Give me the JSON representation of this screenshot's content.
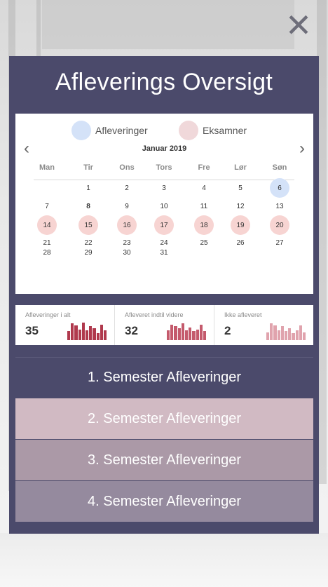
{
  "close_icon": "close-icon",
  "title": "Afleverings Oversigt",
  "legend": [
    {
      "label": "Afleveringer",
      "color": "#d4e2f8"
    },
    {
      "label": "Eksamner",
      "color": "#f0d8da"
    }
  ],
  "calendar": {
    "month": "Januar 2019",
    "prev_icon": "chevron-left-icon",
    "next_icon": "chevron-right-icon",
    "weekdays": [
      "Man",
      "Tir",
      "Ons",
      "Tors",
      "Fre",
      "Lør",
      "Søn"
    ],
    "weeks": [
      [
        {
          "d": ""
        },
        {
          "d": "1"
        },
        {
          "d": "2"
        },
        {
          "d": "3"
        },
        {
          "d": "4"
        },
        {
          "d": "5"
        },
        {
          "d": "6",
          "type": "deliv"
        }
      ],
      [
        {
          "d": "7"
        },
        {
          "d": "8",
          "bold": true
        },
        {
          "d": "9"
        },
        {
          "d": "10"
        },
        {
          "d": "11"
        },
        {
          "d": "12"
        },
        {
          "d": "13"
        }
      ],
      [
        {
          "d": "14",
          "type": "exam"
        },
        {
          "d": "15",
          "type": "exam"
        },
        {
          "d": "16",
          "type": "exam"
        },
        {
          "d": "17",
          "type": "exam"
        },
        {
          "d": "18",
          "type": "exam"
        },
        {
          "d": "19",
          "type": "exam"
        },
        {
          "d": "20",
          "type": "exam"
        }
      ],
      [
        {
          "d": "21"
        },
        {
          "d": "22"
        },
        {
          "d": "23"
        },
        {
          "d": "24"
        },
        {
          "d": "25"
        },
        {
          "d": "26"
        },
        {
          "d": "27"
        }
      ],
      [
        {
          "d": "28"
        },
        {
          "d": "29"
        },
        {
          "d": "30"
        },
        {
          "d": "31"
        },
        {
          "d": ""
        },
        {
          "d": ""
        },
        {
          "d": ""
        }
      ]
    ]
  },
  "stats": [
    {
      "label": "Afleveringer i alt",
      "value": "35",
      "color": "#b0394d",
      "bars": [
        0.45,
        0.85,
        0.75,
        0.55,
        0.9,
        0.5,
        0.7,
        0.6,
        0.35,
        0.8,
        0.5
      ]
    },
    {
      "label": "Afleveret indtil videre",
      "value": "32",
      "color": "#c45a6c",
      "bars": [
        0.5,
        0.8,
        0.7,
        0.6,
        0.85,
        0.5,
        0.65,
        0.45,
        0.55,
        0.8,
        0.45
      ]
    },
    {
      "label": "Ikke afleveret",
      "value": "2",
      "color": "#e0a3ad",
      "bars": [
        0.4,
        0.85,
        0.75,
        0.5,
        0.7,
        0.45,
        0.6,
        0.35,
        0.5,
        0.75,
        0.4
      ]
    }
  ],
  "semesters": [
    {
      "label": "1. Semester Afleveringer",
      "color": "#4b4a6b"
    },
    {
      "label": "2. Semester Afleveringer",
      "color": "#d1bac3"
    },
    {
      "label": "3. Semester Afleveringer",
      "color": "#ab99a7"
    },
    {
      "label": "4. Semester Afleveringer",
      "color": "#958a9e"
    }
  ]
}
